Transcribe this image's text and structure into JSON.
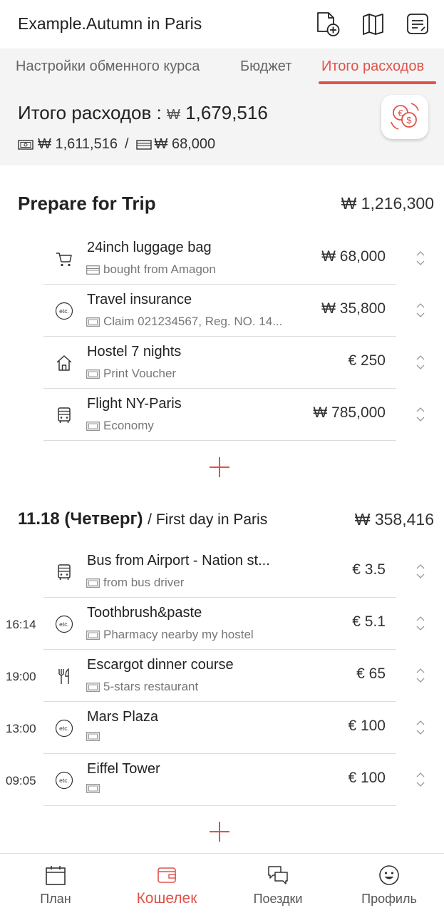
{
  "header": {
    "title": "Example.Autumn in Paris"
  },
  "tabs": [
    {
      "label": "Настройки обменного курса",
      "active": false
    },
    {
      "label": "Бюджет",
      "active": false
    },
    {
      "label": "Итого расходов",
      "active": true
    }
  ],
  "summary": {
    "label": "Итого расходов :",
    "currency_symbol": "₩",
    "total": "1,679,516",
    "cash_amount": "1,611,516",
    "separator": "/",
    "card_amount": "68,000"
  },
  "sections": [
    {
      "title": "Prepare for Trip",
      "total": "₩ 1,216,300",
      "items": [
        {
          "time": "",
          "icon": "cart-icon",
          "name": "24inch luggage bag",
          "payment": "card",
          "note": "bought from Amagon",
          "amount": "₩ 68,000"
        },
        {
          "time": "",
          "icon": "etc-icon",
          "name": "Travel insurance",
          "payment": "cash",
          "note": "Claim 021234567, Reg. NO. 14...",
          "amount": "₩ 35,800"
        },
        {
          "time": "",
          "icon": "house-icon",
          "name": "Hostel 7 nights",
          "payment": "cash",
          "note": "Print Voucher",
          "amount": "€ 250"
        },
        {
          "time": "",
          "icon": "bus-icon",
          "name": "Flight NY-Paris",
          "payment": "cash",
          "note": "Economy",
          "amount": "₩ 785,000"
        }
      ]
    },
    {
      "date": "11.18",
      "weekday": "(Четверг)",
      "subtitle": "/ First day in Paris",
      "total": "₩ 358,416",
      "items": [
        {
          "time": "",
          "icon": "bus-icon",
          "name": "Bus from Airport - Nation st...",
          "payment": "cash",
          "note": "from bus driver",
          "amount": "€ 3.5"
        },
        {
          "time": "16:14",
          "icon": "etc-icon",
          "name": "Toothbrush&paste",
          "payment": "cash",
          "note": "Pharmacy nearby my hostel",
          "amount": "€ 5.1"
        },
        {
          "time": "19:00",
          "icon": "cutlery-icon",
          "name": "Escargot dinner course",
          "payment": "cash",
          "note": "5-stars restaurant",
          "amount": "€ 65"
        },
        {
          "time": "13:00",
          "icon": "etc-icon",
          "name": "Mars Plaza",
          "payment": "cash",
          "note": "",
          "amount": "€ 100"
        },
        {
          "time": "09:05",
          "icon": "etc-icon",
          "name": "Eiffel Tower",
          "payment": "cash",
          "note": "",
          "amount": "€ 100"
        }
      ]
    }
  ],
  "nav": [
    {
      "label": "План",
      "icon": "calendar-icon",
      "active": false
    },
    {
      "label": "Кошелек",
      "icon": "wallet-icon",
      "active": true
    },
    {
      "label": "Поездки",
      "icon": "chat-icon",
      "active": false
    },
    {
      "label": "Профиль",
      "icon": "smiley-icon",
      "active": false
    }
  ],
  "colors": {
    "accent": "#e0534a",
    "panel": "#f4f4f4",
    "divider": "#dcdcdc"
  }
}
